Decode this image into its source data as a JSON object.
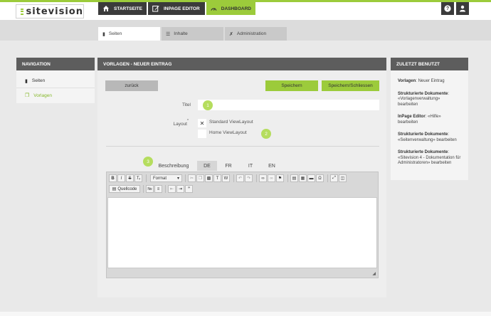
{
  "brand": {
    "logo_text": "sitevision"
  },
  "topnav": {
    "items": [
      {
        "label": "STARTSEITE",
        "icon": "home-icon"
      },
      {
        "label": "INPAGE EDITOR",
        "icon": "edit-icon"
      },
      {
        "label": "DASHBOARD",
        "icon": "dashboard-gauge-icon"
      }
    ],
    "help_icon": "?",
    "accent": "#9ccb3b"
  },
  "tabs": [
    {
      "label": "Seiten",
      "icon": "page-icon"
    },
    {
      "label": "Inhalte",
      "icon": "list-icon"
    },
    {
      "label": "Administration",
      "icon": "tools-icon"
    }
  ],
  "navigation": {
    "title": "NAVIGATION",
    "items": [
      {
        "label": "Seiten",
        "icon": "page-icon"
      },
      {
        "label": "Vorlagen",
        "icon": "template-icon"
      }
    ]
  },
  "main": {
    "title": "VORLAGEN - NEUER EINTRAG",
    "back_label": "zurück",
    "save_label": "Speichern",
    "save_close_label": "Speichern/Schliessen",
    "title_label": "Titel",
    "title_value": "",
    "layout_label": "Layout",
    "required_mark": "*",
    "layout_options": [
      "Standard ViewLayout",
      "Home ViewLayout"
    ],
    "layout_selected": "Standard ViewLayout",
    "badges": [
      "1",
      "2",
      "3"
    ],
    "description_label": "Beschreibung",
    "languages": [
      "DE",
      "FR",
      "IT",
      "EN"
    ],
    "active_language": "DE",
    "editor": {
      "format_label": "Format",
      "source_label": "Quellcode",
      "content": ""
    }
  },
  "recent": {
    "title": "ZULETZT BENUTZT",
    "entries": [
      {
        "bold": "Vorlagen",
        "text": ": Neuer Eintrag"
      },
      {
        "bold": "Strukturierte Dokumente",
        "text": ": «Vorlagenverwaltung» bearbeiten"
      },
      {
        "bold": "InPage Editor",
        "text": ": «Hilfe» bearbeiten"
      },
      {
        "bold": "Strukturierte Dokumente",
        "text": ": «Seitenverwaltung» bearbeiten"
      },
      {
        "bold": "Strukturierte Dokumente",
        "text": ": «Sitevision 4 - Dokumentation für Administratoren» bearbeiten"
      }
    ]
  }
}
